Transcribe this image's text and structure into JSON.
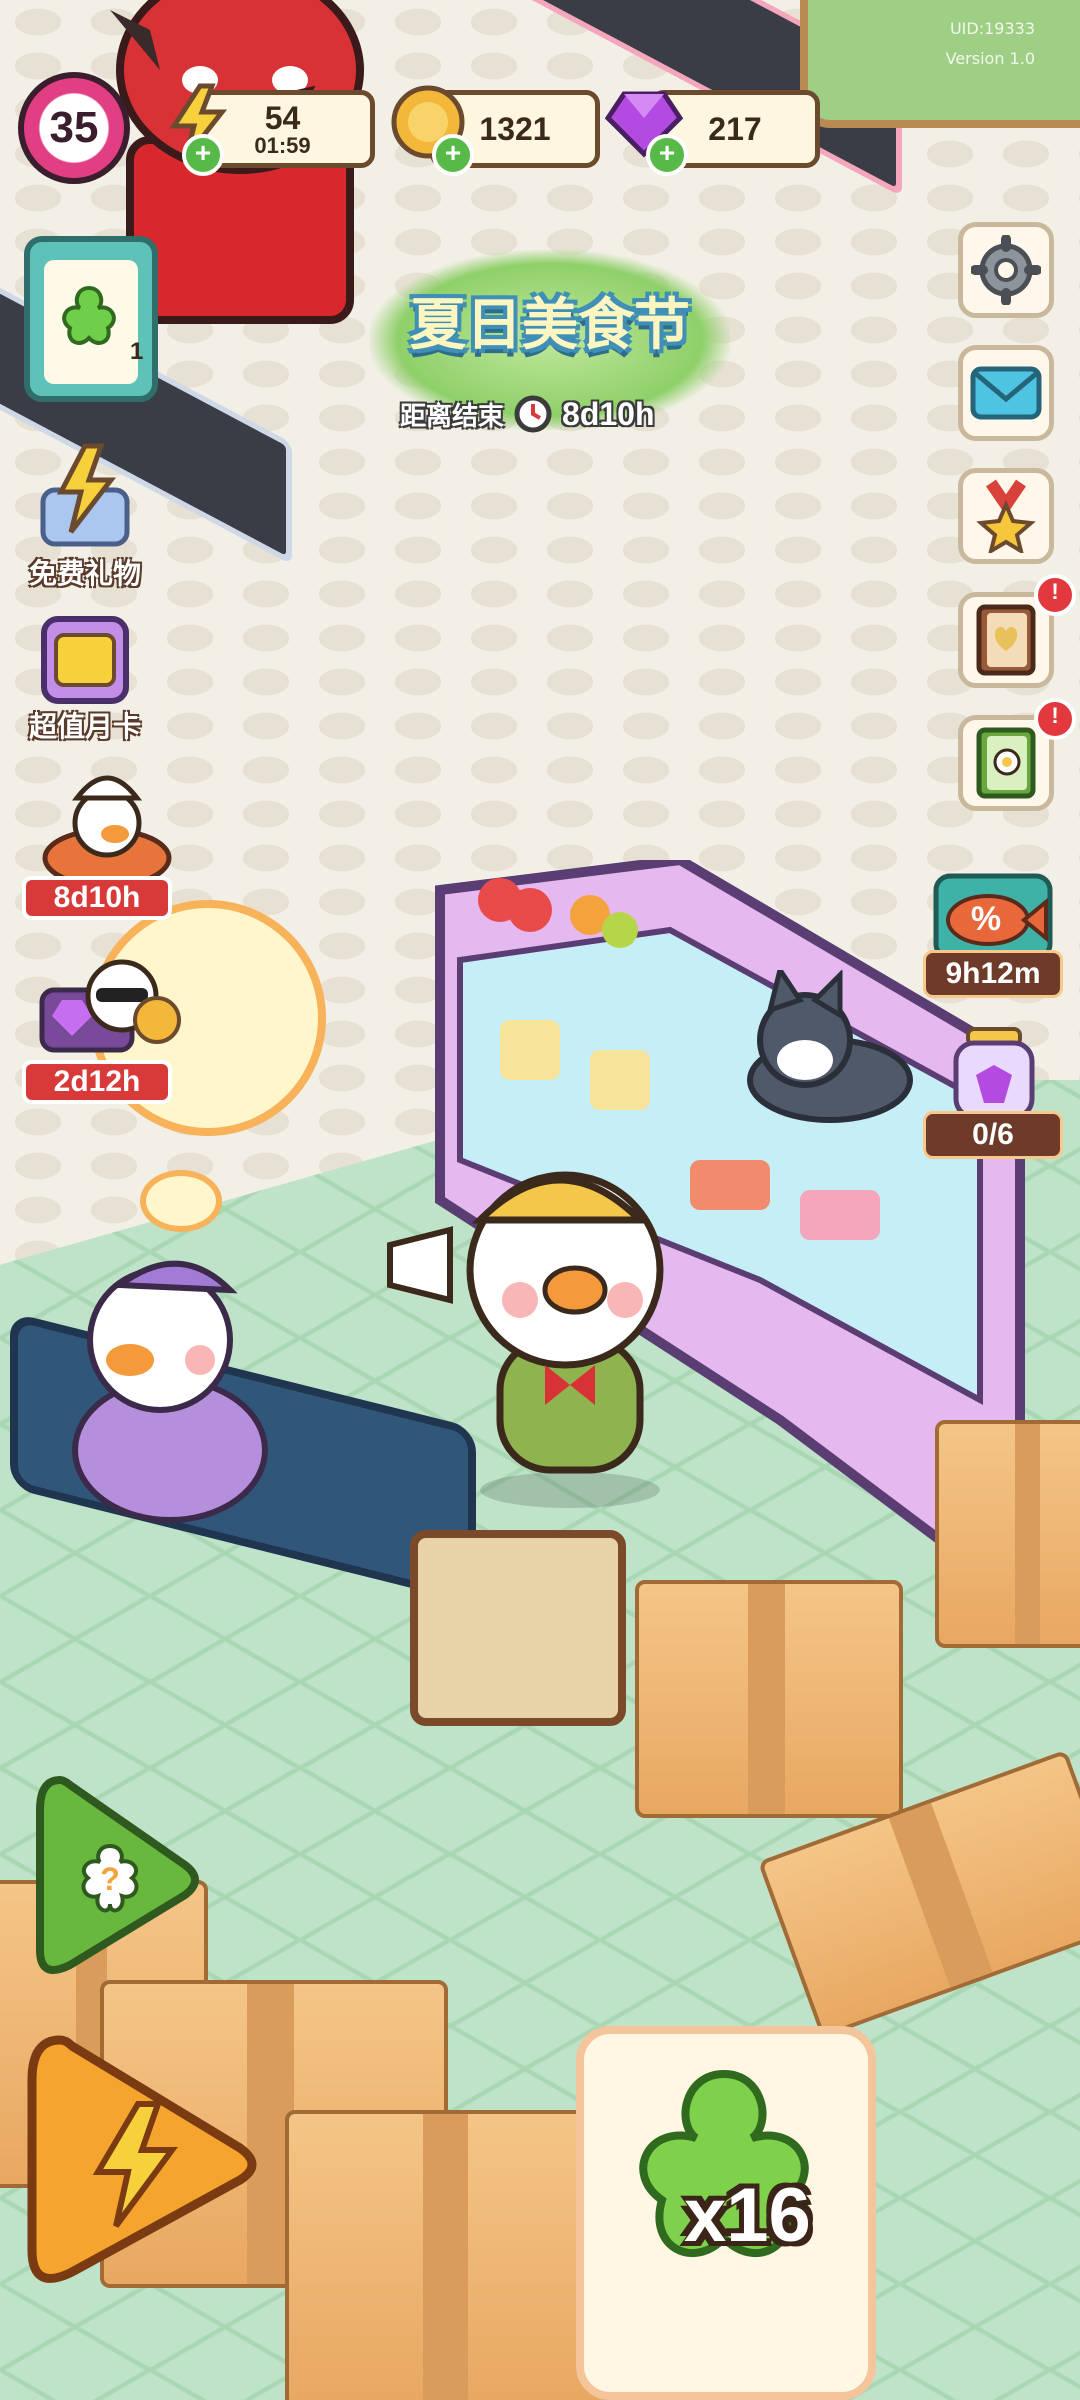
{
  "hud": {
    "level": "35",
    "energy": {
      "value": "54",
      "timer": "01:59"
    },
    "coins": "1321",
    "gems": "217"
  },
  "quest": {
    "count": "1"
  },
  "event": {
    "title": "夏日美食节",
    "ends_label": "距离结束",
    "time_left": "8d10h"
  },
  "left_menu": [
    {
      "label": "免费礼物",
      "icon": "gift-lightning-icon"
    },
    {
      "label": "超值月卡",
      "icon": "monthly-card-icon"
    }
  ],
  "left_timers": [
    {
      "label": "8d10h",
      "icon": "chef-duck-event-icon"
    },
    {
      "label": "2d12h",
      "icon": "sunglasses-duck-gems-icon"
    }
  ],
  "right_menu": [
    {
      "icon": "gear-icon"
    },
    {
      "icon": "mail-icon"
    },
    {
      "icon": "medal-icon"
    },
    {
      "icon": "heart-book-icon",
      "badge": "!"
    },
    {
      "icon": "recipe-book-icon",
      "badge": "!"
    }
  ],
  "right_panels": [
    {
      "label": "9h12m",
      "icon": "discount-fish-icon"
    },
    {
      "label": "0/6",
      "icon": "gem-jar-icon"
    }
  ],
  "bottom": {
    "clover_count": "x16",
    "help_icon": "question-icon",
    "boost_icon": "lightning-icon"
  },
  "watermark": {
    "line1": "UID:19333",
    "line2": "Version 1.0"
  },
  "colors": {
    "accent_green": "#57b947",
    "badge_red": "#e2393f",
    "level_pink": "#e23e83"
  }
}
